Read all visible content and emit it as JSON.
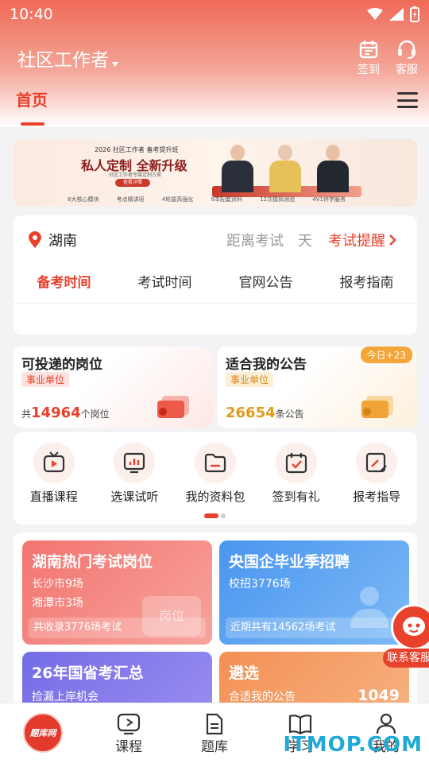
{
  "status": {
    "time": "10:40"
  },
  "header": {
    "app_title": "社区工作者",
    "sign_label": "签到",
    "service_label": "客服"
  },
  "tabs": {
    "home": "首页"
  },
  "banner": {
    "tag": "2026 社区工作者  备考提升班",
    "title": "私人定制  全新升级",
    "subtitle": "社区工作者专属定制方案",
    "button": "查看详情",
    "features": [
      "8大核心模块",
      "考点精讲班",
      "4轮拔高强化",
      "9本配套资料",
      "12次模拟测验",
      "4V1伴学服务"
    ],
    "names": [
      "赵春燕",
      "小雨",
      "大兴"
    ]
  },
  "location": {
    "city": "湖南",
    "distance_label": "距离考试",
    "days_label": "天",
    "reminder": "考试提醒",
    "subtabs": [
      "备考时间",
      "考试时间",
      "官网公告",
      "报考指南"
    ]
  },
  "stats": {
    "left": {
      "title": "可投递的岗位",
      "tag": "事业单位",
      "prefix": "共",
      "count": "14964",
      "suffix": "个岗位"
    },
    "right": {
      "title": "适合我的公告",
      "tag": "事业单位",
      "count": "26654",
      "suffix": "条公告",
      "badge": "今日+23"
    }
  },
  "quick": [
    "直播课程",
    "选课试听",
    "我的资料包",
    "签到有礼",
    "报考指导"
  ],
  "cards": [
    {
      "title": "湖南热门考试岗位",
      "lines": [
        "长沙市9场",
        "湘潭市3场"
      ],
      "footer": "共收录3776场考试",
      "deco": "岗位",
      "color": "#f06a6a"
    },
    {
      "title": "央国企毕业季招聘",
      "lines": [
        "校招3776场"
      ],
      "footer": "近期共有14562场考试",
      "color": "#4c9cf0"
    },
    {
      "title": "26年国省考汇总",
      "lines": [
        "捡漏上岸机会"
      ],
      "color": "#7a72ea"
    },
    {
      "title": "遴选",
      "lines": [
        "合适我的公告"
      ],
      "count": "1049",
      "color": "#f49a5c"
    }
  ],
  "float": {
    "label": "联系客服"
  },
  "nav": {
    "logo": "题库网",
    "items": [
      "课程",
      "题库",
      "学习",
      "我的"
    ]
  },
  "watermark": "ITMOP.COM"
}
